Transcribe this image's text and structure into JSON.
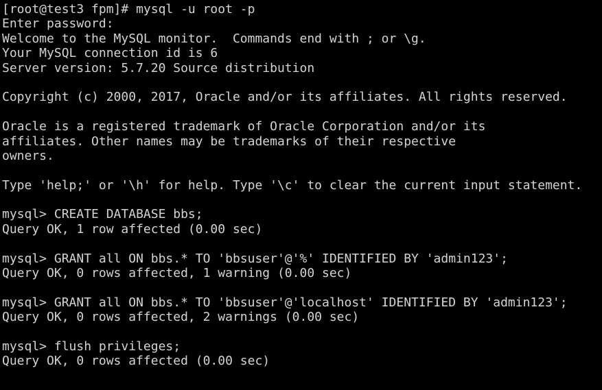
{
  "terminal": {
    "window_title": "Terminal",
    "colors": {
      "background": "#000000",
      "foreground": "#d4d4d4"
    },
    "shell_prompt": "[root@test3 fpm]#",
    "sql_prompt": "mysql>",
    "font_size_px": 18,
    "columns": 79,
    "rows": 26,
    "lines": [
      "[root@test3 fpm]# mysql -u root -p",
      "Enter password:",
      "Welcome to the MySQL monitor.  Commands end with ; or \\g.",
      "Your MySQL connection id is 6",
      "Server version: 5.7.20 Source distribution",
      "",
      "Copyright (c) 2000, 2017, Oracle and/or its affiliates. All rights reserved.",
      "",
      "Oracle is a registered trademark of Oracle Corporation and/or its",
      "affiliates. Other names may be trademarks of their respective",
      "owners.",
      "",
      "Type 'help;' or '\\h' for help. Type '\\c' to clear the current input statement.",
      "",
      "mysql> CREATE DATABASE bbs;",
      "Query OK, 1 row affected (0.00 sec)",
      "",
      "mysql> GRANT all ON bbs.* TO 'bbsuser'@'%' IDENTIFIED BY 'admin123';",
      "Query OK, 0 rows affected, 1 warning (0.00 sec)",
      "",
      "mysql> GRANT all ON bbs.* TO 'bbsuser'@'localhost' IDENTIFIED BY 'admin123';",
      "Query OK, 0 rows affected, 2 warnings (0.00 sec)",
      "",
      "mysql> flush privileges;",
      "Query OK, 0 rows affected (0.00 sec)",
      ""
    ]
  }
}
